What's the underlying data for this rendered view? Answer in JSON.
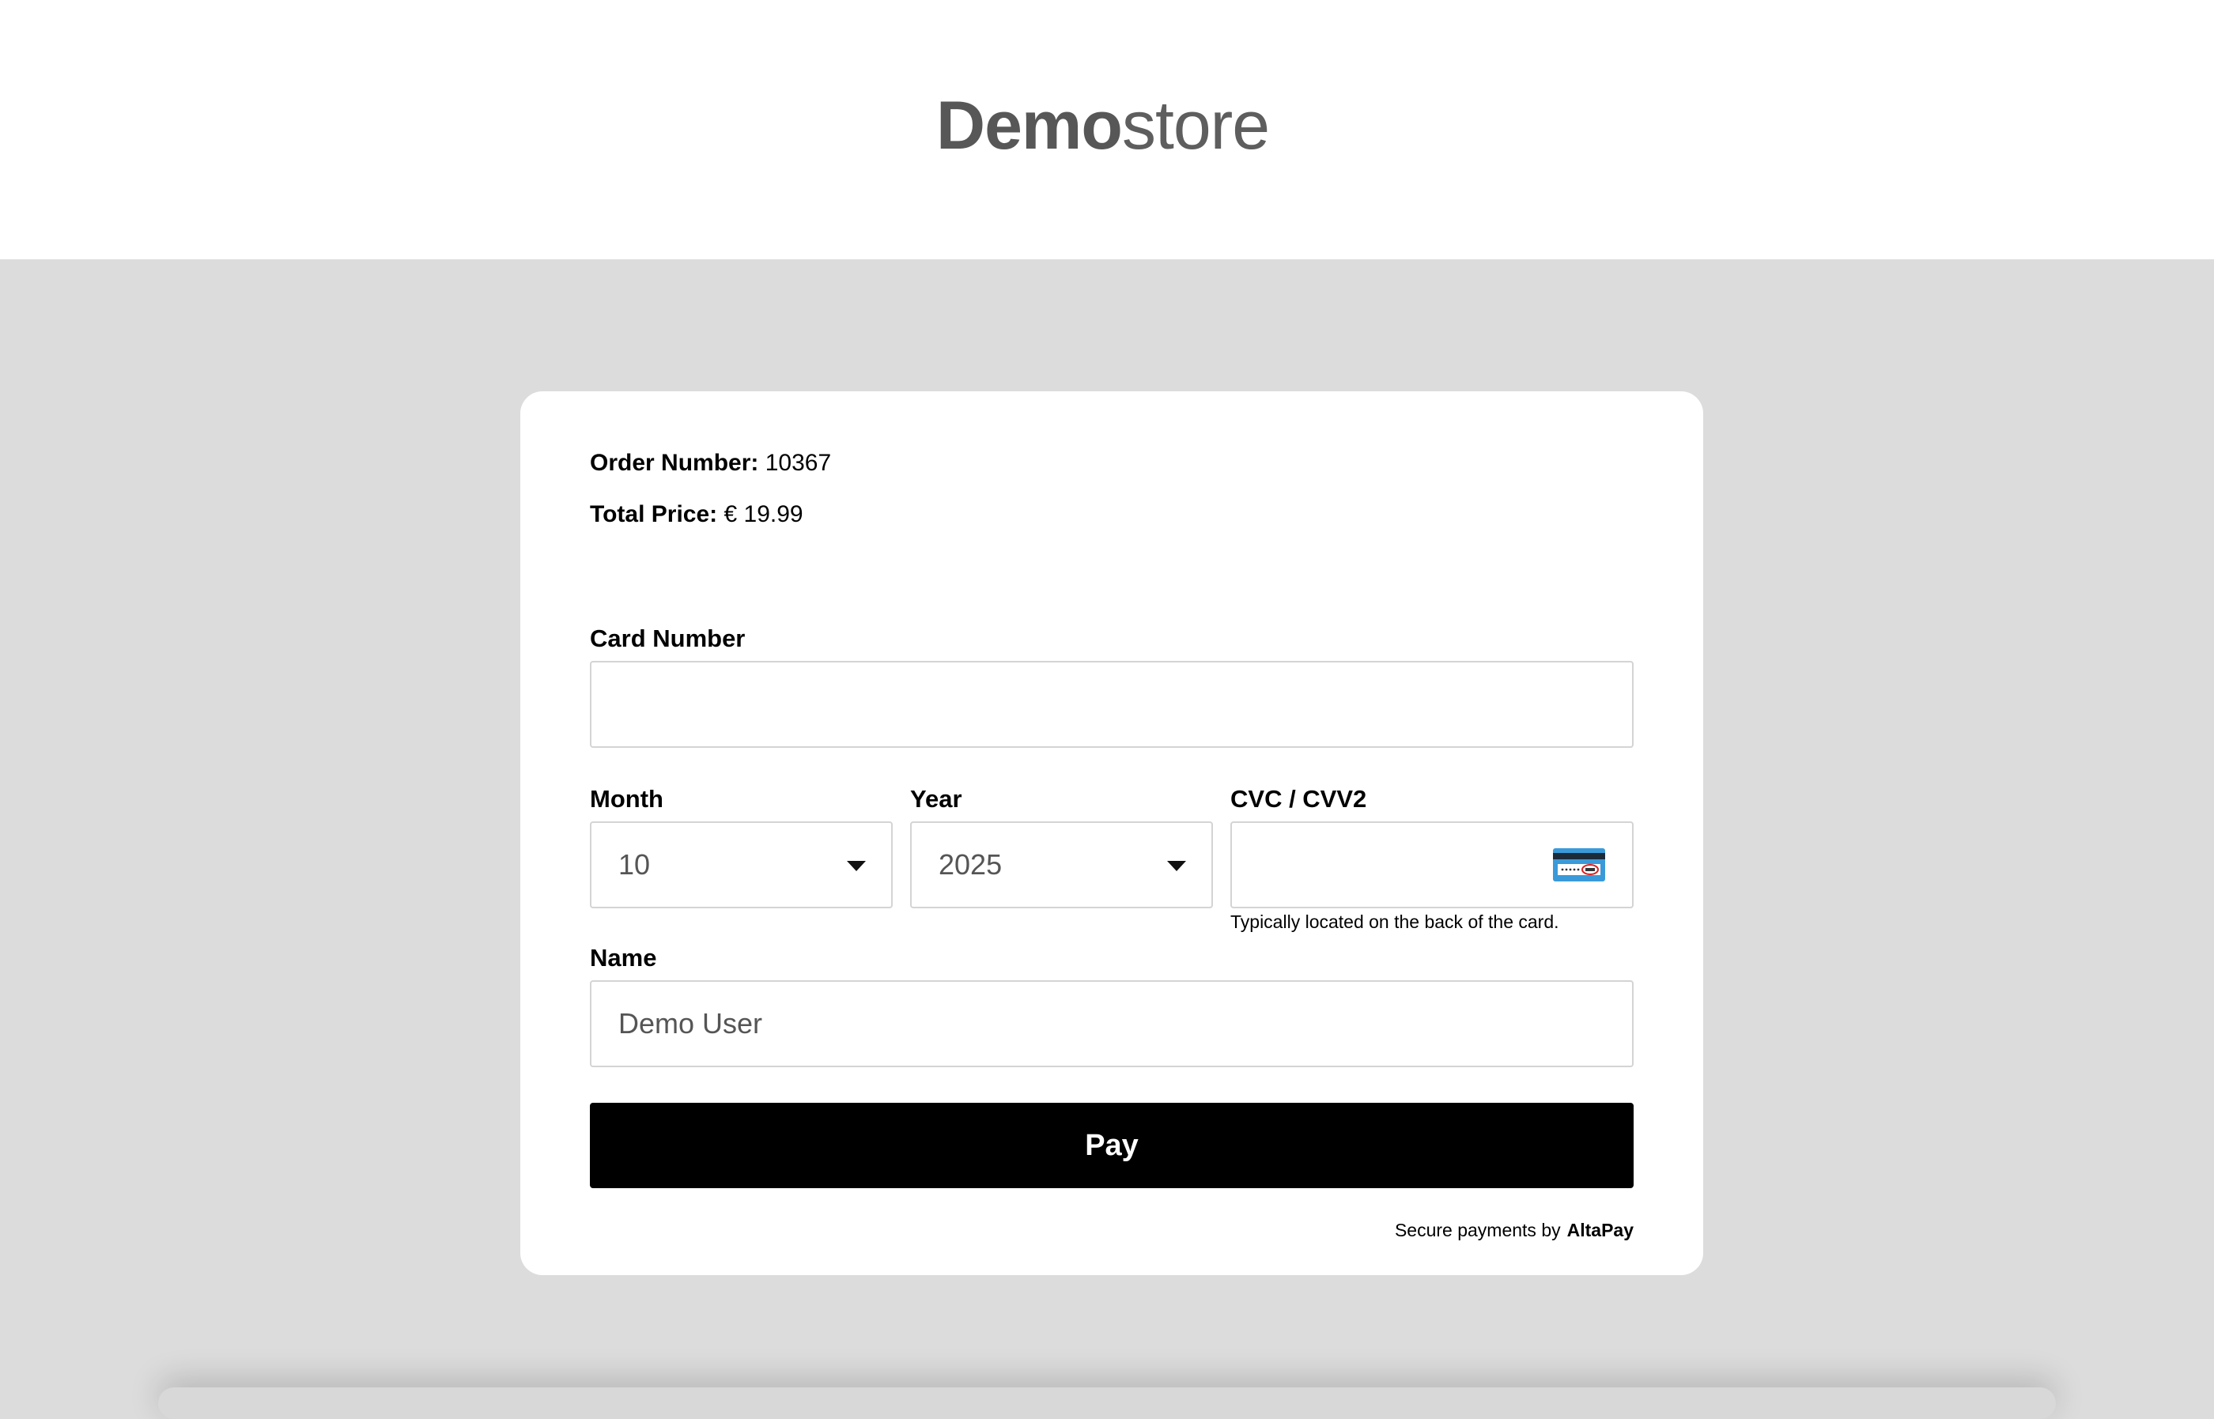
{
  "brand": {
    "logo_bold": "Demo",
    "logo_light": "store"
  },
  "order": {
    "number_label": "Order Number:",
    "number_value": "10367",
    "price_label": "Total Price:",
    "price_value": "€ 19.99"
  },
  "form": {
    "card_number_label": "Card Number",
    "card_number_value": "",
    "month_label": "Month",
    "month_value": "10",
    "year_label": "Year",
    "year_value": "2025",
    "cvc_label": "CVC / CVV2",
    "cvc_value": "",
    "cvc_hint": "Typically located on the back of the card.",
    "name_label": "Name",
    "name_value": "Demo User",
    "pay_label": "Pay"
  },
  "footer": {
    "secure_text": "Secure payments by",
    "secure_brand": "AltaPay"
  },
  "colors": {
    "page_background": "#dcdcdc",
    "button": "#000000",
    "logo": "#575757"
  },
  "icons": {
    "cvc": "card-back-cvc-icon",
    "dropdown": "chevron-down-icon"
  }
}
